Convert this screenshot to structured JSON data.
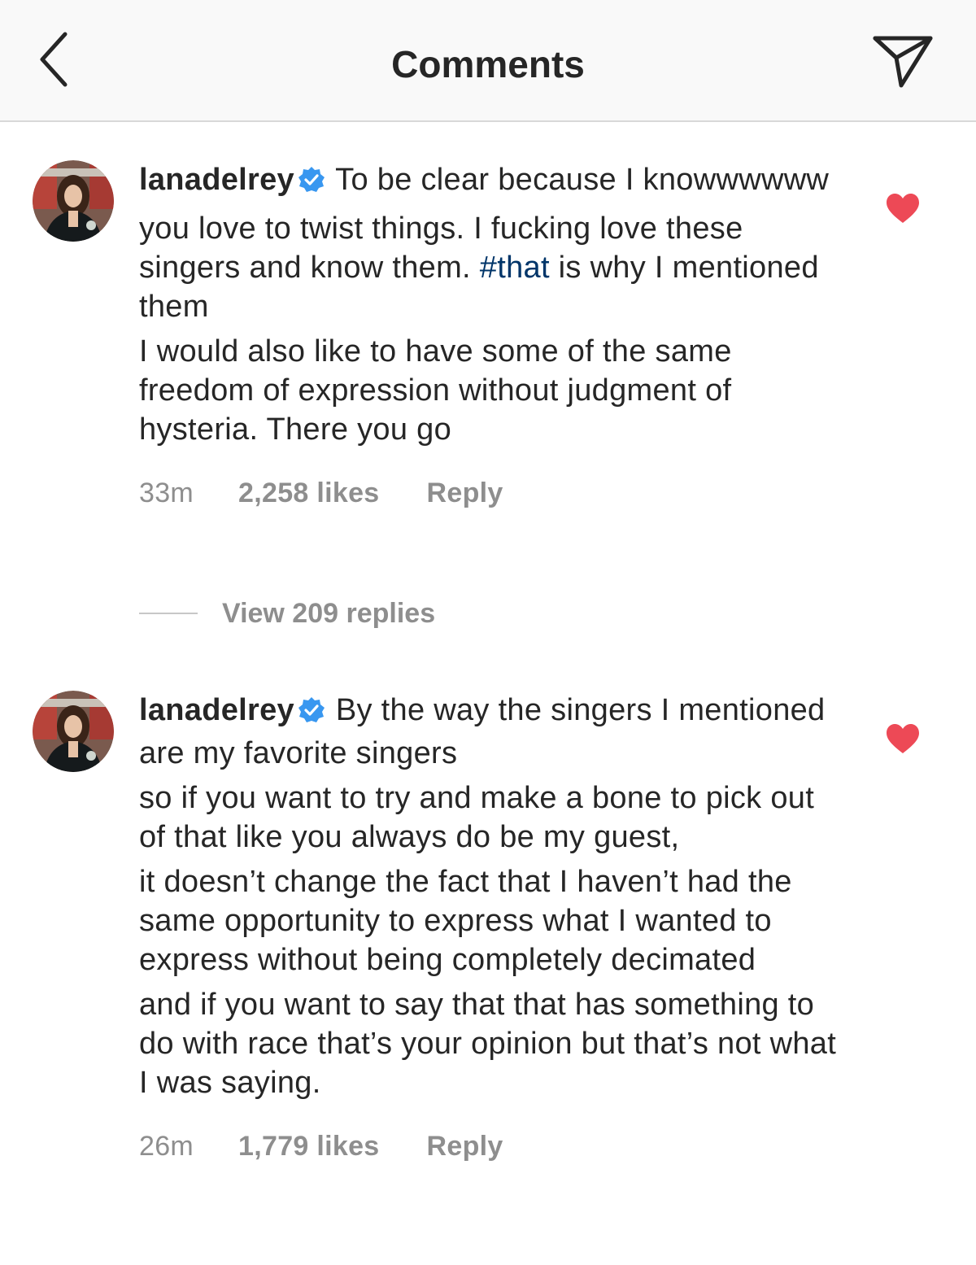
{
  "header": {
    "title": "Comments",
    "back_icon": "chevron-left-icon",
    "share_icon": "paper-plane-icon"
  },
  "colors": {
    "heart": "#ed4956",
    "verified": "#3897f0",
    "hashtag": "#003569",
    "meta_text": "#8e8e8e"
  },
  "comments": [
    {
      "username": "lanadelrey",
      "verified": true,
      "liked": true,
      "paragraphs": [
        {
          "lead": "To be clear because I knowwwwww"
        },
        {
          "before": "you love to twist things. I fucking love these singers and know them. ",
          "hashtag": "#that",
          "after": " is why I mentioned them"
        },
        {
          "text": "I would also like to have some of the same freedom of expression without judgment of hysteria. There you go"
        }
      ],
      "time": "33m",
      "likes": "2,258 likes",
      "reply_label": "Reply"
    },
    {
      "username": "lanadelrey",
      "verified": true,
      "liked": true,
      "paragraphs": [
        {
          "lead": "By the way the singers I mentioned are my favorite singers"
        },
        {
          "text": "so if you want to try and make a bone to pick out of that like you always do be my guest,"
        },
        {
          "text": "it doesn’t change the fact that I haven’t had the same opportunity to express what I wanted to express without being completely decimated"
        },
        {
          "text": "and if you want to say that that has something to do with race that’s your opinion but that’s not what I was saying."
        }
      ],
      "time": "26m",
      "likes": "1,779 likes",
      "reply_label": "Reply"
    }
  ],
  "view_replies": "View 209 replies"
}
